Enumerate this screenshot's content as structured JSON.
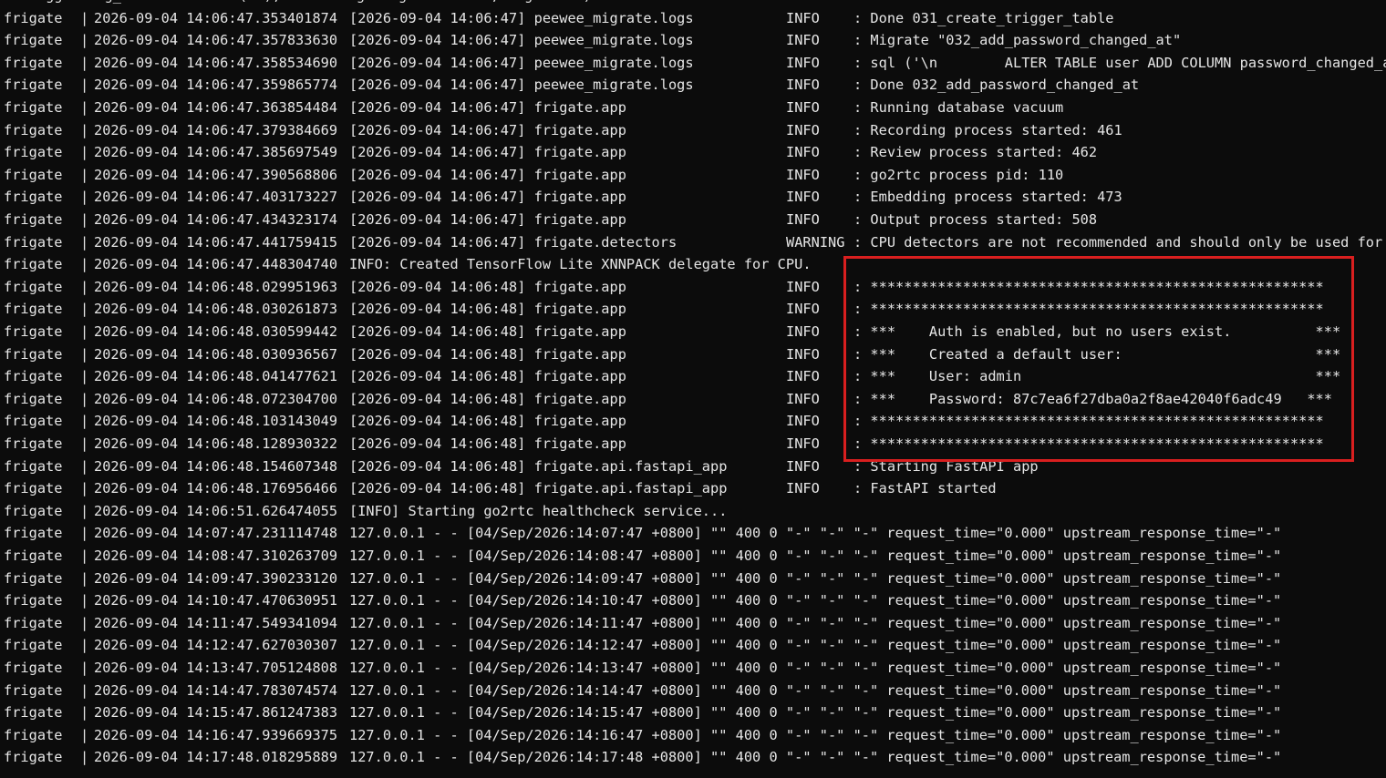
{
  "window": {
    "title": ""
  },
  "colors": {
    "background": "#0c0c0c",
    "text": "#e6e6e6",
    "highlight": "#d91f1f"
  },
  "log": {
    "top_fragment": "   logger log_ct  ctor  ch  (ee),  ee   log  log  o.  on  , log  ol  )",
    "lines": [
      {
        "source": "frigate",
        "pipe": "|",
        "timestamp": "2026-09-04 14:06:47.353401874",
        "rest": "[2026-09-04 14:06:47] peewee_migrate.logs",
        "level": "INFO",
        "message": ": Done 031_create_trigger_table"
      },
      {
        "source": "frigate",
        "pipe": "|",
        "timestamp": "2026-09-04 14:06:47.357833630",
        "rest": "[2026-09-04 14:06:47] peewee_migrate.logs",
        "level": "INFO",
        "message": ": Migrate \"032_add_password_changed_at\""
      },
      {
        "source": "frigate",
        "pipe": "|",
        "timestamp": "2026-09-04 14:06:47.358534690",
        "rest": "[2026-09-04 14:06:47] peewee_migrate.logs",
        "level": "INFO",
        "message": ": sql ('\\n        ALTER TABLE user ADD COLUMN password_changed_at"
      },
      {
        "source": "frigate",
        "pipe": "|",
        "timestamp": "2026-09-04 14:06:47.359865774",
        "rest": "[2026-09-04 14:06:47] peewee_migrate.logs",
        "level": "INFO",
        "message": ": Done 032_add_password_changed_at"
      },
      {
        "source": "frigate",
        "pipe": "|",
        "timestamp": "2026-09-04 14:06:47.363854484",
        "rest": "[2026-09-04 14:06:47] frigate.app",
        "level": "INFO",
        "message": ": Running database vacuum"
      },
      {
        "source": "frigate",
        "pipe": "|",
        "timestamp": "2026-09-04 14:06:47.379384669",
        "rest": "[2026-09-04 14:06:47] frigate.app",
        "level": "INFO",
        "message": ": Recording process started: 461"
      },
      {
        "source": "frigate",
        "pipe": "|",
        "timestamp": "2026-09-04 14:06:47.385697549",
        "rest": "[2026-09-04 14:06:47] frigate.app",
        "level": "INFO",
        "message": ": Review process started: 462"
      },
      {
        "source": "frigate",
        "pipe": "|",
        "timestamp": "2026-09-04 14:06:47.390568806",
        "rest": "[2026-09-04 14:06:47] frigate.app",
        "level": "INFO",
        "message": ": go2rtc process pid: 110"
      },
      {
        "source": "frigate",
        "pipe": "|",
        "timestamp": "2026-09-04 14:06:47.403173227",
        "rest": "[2026-09-04 14:06:47] frigate.app",
        "level": "INFO",
        "message": ": Embedding process started: 473"
      },
      {
        "source": "frigate",
        "pipe": "|",
        "timestamp": "2026-09-04 14:06:47.434323174",
        "rest": "[2026-09-04 14:06:47] frigate.app",
        "level": "INFO",
        "message": ": Output process started: 508"
      },
      {
        "source": "frigate",
        "pipe": "|",
        "timestamp": "2026-09-04 14:06:47.441759415",
        "rest": "[2026-09-04 14:06:47] frigate.detectors",
        "level": "WARNING",
        "message": ": CPU detectors are not recommended and should only be used for t"
      },
      {
        "source": "frigate",
        "pipe": "|",
        "timestamp": "2026-09-04 14:06:47.448304740",
        "rest": "INFO: Created TensorFlow Lite XNNPACK delegate for CPU.",
        "level": "",
        "message": ""
      },
      {
        "source": "frigate",
        "pipe": "|",
        "timestamp": "2026-09-04 14:06:48.029951963",
        "rest": "[2026-09-04 14:06:48] frigate.app",
        "level": "INFO",
        "message": ": ******************************************************"
      },
      {
        "source": "frigate",
        "pipe": "|",
        "timestamp": "2026-09-04 14:06:48.030261873",
        "rest": "[2026-09-04 14:06:48] frigate.app",
        "level": "INFO",
        "message": ": ******************************************************"
      },
      {
        "source": "frigate",
        "pipe": "|",
        "timestamp": "2026-09-04 14:06:48.030599442",
        "rest": "[2026-09-04 14:06:48] frigate.app",
        "level": "INFO",
        "message": ": ***    Auth is enabled, but no users exist.          ***"
      },
      {
        "source": "frigate",
        "pipe": "|",
        "timestamp": "2026-09-04 14:06:48.030936567",
        "rest": "[2026-09-04 14:06:48] frigate.app",
        "level": "INFO",
        "message": ": ***    Created a default user:                       ***"
      },
      {
        "source": "frigate",
        "pipe": "|",
        "timestamp": "2026-09-04 14:06:48.041477621",
        "rest": "[2026-09-04 14:06:48] frigate.app",
        "level": "INFO",
        "message": ": ***    User: admin                                   ***"
      },
      {
        "source": "frigate",
        "pipe": "|",
        "timestamp": "2026-09-04 14:06:48.072304700",
        "rest": "[2026-09-04 14:06:48] frigate.app",
        "level": "INFO",
        "message": ": ***    Password: 87c7ea6f27dba0a2f8ae42040f6adc49   ***"
      },
      {
        "source": "frigate",
        "pipe": "|",
        "timestamp": "2026-09-04 14:06:48.103143049",
        "rest": "[2026-09-04 14:06:48] frigate.app",
        "level": "INFO",
        "message": ": ******************************************************"
      },
      {
        "source": "frigate",
        "pipe": "|",
        "timestamp": "2026-09-04 14:06:48.128930322",
        "rest": "[2026-09-04 14:06:48] frigate.app",
        "level": "INFO",
        "message": ": ******************************************************"
      },
      {
        "source": "frigate",
        "pipe": "|",
        "timestamp": "2026-09-04 14:06:48.154607348",
        "rest": "[2026-09-04 14:06:48] frigate.api.fastapi_app",
        "level": "INFO",
        "message": ": Starting FastAPI app"
      },
      {
        "source": "frigate",
        "pipe": "|",
        "timestamp": "2026-09-04 14:06:48.176956466",
        "rest": "[2026-09-04 14:06:48] frigate.api.fastapi_app",
        "level": "INFO",
        "message": ": FastAPI started"
      },
      {
        "source": "frigate",
        "pipe": "|",
        "timestamp": "2026-09-04 14:06:51.626474055",
        "rest": "[INFO] Starting go2rtc healthcheck service...",
        "level": "",
        "message": ""
      },
      {
        "source": "frigate",
        "pipe": "|",
        "timestamp": "2026-09-04 14:07:47.231114748",
        "rest": "127.0.0.1 - - [04/Sep/2026:14:07:47 +0800] \"\" 400 0 \"-\" \"-\" \"-\" request_time=\"0.000\" upstream_response_time=\"-\"",
        "level": "",
        "message": ""
      },
      {
        "source": "frigate",
        "pipe": "|",
        "timestamp": "2026-09-04 14:08:47.310263709",
        "rest": "127.0.0.1 - - [04/Sep/2026:14:08:47 +0800] \"\" 400 0 \"-\" \"-\" \"-\" request_time=\"0.000\" upstream_response_time=\"-\"",
        "level": "",
        "message": ""
      },
      {
        "source": "frigate",
        "pipe": "|",
        "timestamp": "2026-09-04 14:09:47.390233120",
        "rest": "127.0.0.1 - - [04/Sep/2026:14:09:47 +0800] \"\" 400 0 \"-\" \"-\" \"-\" request_time=\"0.000\" upstream_response_time=\"-\"",
        "level": "",
        "message": ""
      },
      {
        "source": "frigate",
        "pipe": "|",
        "timestamp": "2026-09-04 14:10:47.470630951",
        "rest": "127.0.0.1 - - [04/Sep/2026:14:10:47 +0800] \"\" 400 0 \"-\" \"-\" \"-\" request_time=\"0.000\" upstream_response_time=\"-\"",
        "level": "",
        "message": ""
      },
      {
        "source": "frigate",
        "pipe": "|",
        "timestamp": "2026-09-04 14:11:47.549341094",
        "rest": "127.0.0.1 - - [04/Sep/2026:14:11:47 +0800] \"\" 400 0 \"-\" \"-\" \"-\" request_time=\"0.000\" upstream_response_time=\"-\"",
        "level": "",
        "message": ""
      },
      {
        "source": "frigate",
        "pipe": "|",
        "timestamp": "2026-09-04 14:12:47.627030307",
        "rest": "127.0.0.1 - - [04/Sep/2026:14:12:47 +0800] \"\" 400 0 \"-\" \"-\" \"-\" request_time=\"0.000\" upstream_response_time=\"-\"",
        "level": "",
        "message": ""
      },
      {
        "source": "frigate",
        "pipe": "|",
        "timestamp": "2026-09-04 14:13:47.705124808",
        "rest": "127.0.0.1 - - [04/Sep/2026:14:13:47 +0800] \"\" 400 0 \"-\" \"-\" \"-\" request_time=\"0.000\" upstream_response_time=\"-\"",
        "level": "",
        "message": ""
      },
      {
        "source": "frigate",
        "pipe": "|",
        "timestamp": "2026-09-04 14:14:47.783074574",
        "rest": "127.0.0.1 - - [04/Sep/2026:14:14:47 +0800] \"\" 400 0 \"-\" \"-\" \"-\" request_time=\"0.000\" upstream_response_time=\"-\"",
        "level": "",
        "message": ""
      },
      {
        "source": "frigate",
        "pipe": "|",
        "timestamp": "2026-09-04 14:15:47.861247383",
        "rest": "127.0.0.1 - - [04/Sep/2026:14:15:47 +0800] \"\" 400 0 \"-\" \"-\" \"-\" request_time=\"0.000\" upstream_response_time=\"-\"",
        "level": "",
        "message": ""
      },
      {
        "source": "frigate",
        "pipe": "|",
        "timestamp": "2026-09-04 14:16:47.939669375",
        "rest": "127.0.0.1 - - [04/Sep/2026:14:16:47 +0800] \"\" 400 0 \"-\" \"-\" \"-\" request_time=\"0.000\" upstream_response_time=\"-\"",
        "level": "",
        "message": ""
      },
      {
        "source": "frigate",
        "pipe": "|",
        "timestamp": "2026-09-04 14:17:48.018295889",
        "rest": "127.0.0.1 - - [04/Sep/2026:14:17:48 +0800] \"\" 400 0 \"-\" \"-\" \"-\" request_time=\"0.000\" upstream_response_time=\"-\"",
        "level": "",
        "message": ""
      }
    ]
  }
}
